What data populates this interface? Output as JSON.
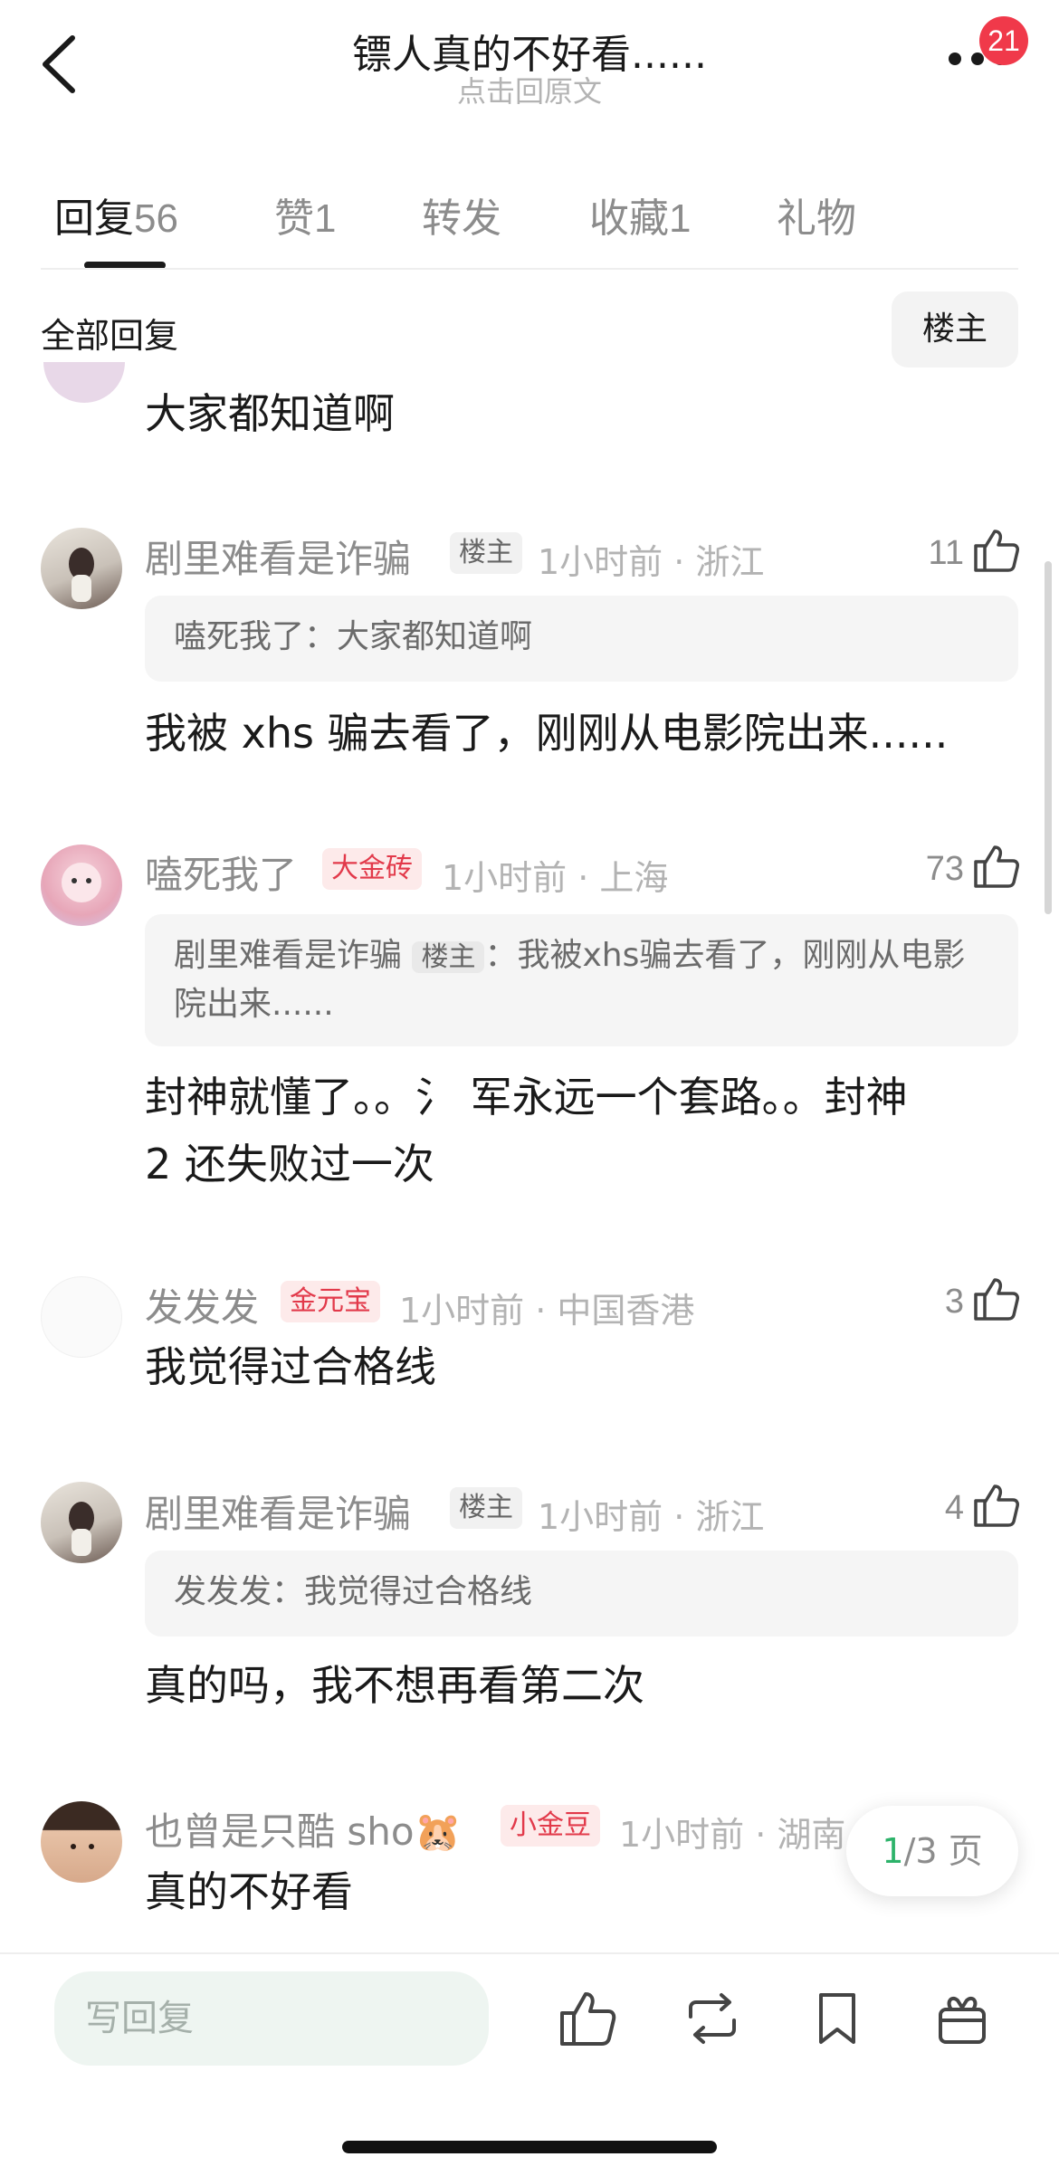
{
  "header": {
    "title": "镖人真的不好看......",
    "subtitle": "点击回原文",
    "notification_count": "21"
  },
  "tabs": [
    {
      "label": "回复",
      "count": "56"
    },
    {
      "label": "赞",
      "count": "1"
    },
    {
      "label": "转发",
      "count": ""
    },
    {
      "label": "收藏",
      "count": "1"
    },
    {
      "label": "礼物",
      "count": ""
    }
  ],
  "section": {
    "title": "全部回复",
    "filter_label": "楼主"
  },
  "comments": [
    {
      "body": "大家都知道啊"
    },
    {
      "user": "剧里难看是诈骗",
      "tag": "楼主",
      "time": "1小时前 · 浙江",
      "likes": "11",
      "quote": {
        "user": "嗑死我了",
        "sep": "：",
        "text": "大家都知道啊"
      },
      "body": "我被 xhs 骗去看了，刚刚从电影院出来......"
    },
    {
      "user": "嗑死我了",
      "tag": "大金砖",
      "time": "1小时前 · 上海",
      "likes": "73",
      "quote": {
        "user": "剧里难看是诈骗",
        "tag": "楼主",
        "sep": "：",
        "text": "我被xhs骗去看了，刚刚从电影院出来......"
      },
      "body_line1": "封神就懂了。。氵 军永远一个套路。。封神",
      "body_line2": "2 还失败过一次"
    },
    {
      "user": "发发发",
      "tag": "金元宝",
      "time": "1小时前 · 中国香港",
      "likes": "3",
      "body": "我觉得过合格线"
    },
    {
      "user": "剧里难看是诈骗",
      "tag": "楼主",
      "time": "1小时前 · 浙江",
      "likes": "4",
      "quote": {
        "user": "发发发",
        "sep": "：",
        "text": "我觉得过合格线"
      },
      "body": "真的吗，我不想再看第二次"
    },
    {
      "user": "也曾是只酷 sho",
      "user_emoji": "🐹",
      "tag": "小金豆",
      "time": "1小时前 · 湖南",
      "body": "真的不好看"
    }
  ],
  "pager": {
    "current": "1",
    "total": "/3 页"
  },
  "bottom_bar": {
    "reply_placeholder": "写回复"
  },
  "colors": {
    "accent_green": "#2db36a",
    "tag_red": "#e2394a",
    "badge_red": "#f0394a"
  }
}
